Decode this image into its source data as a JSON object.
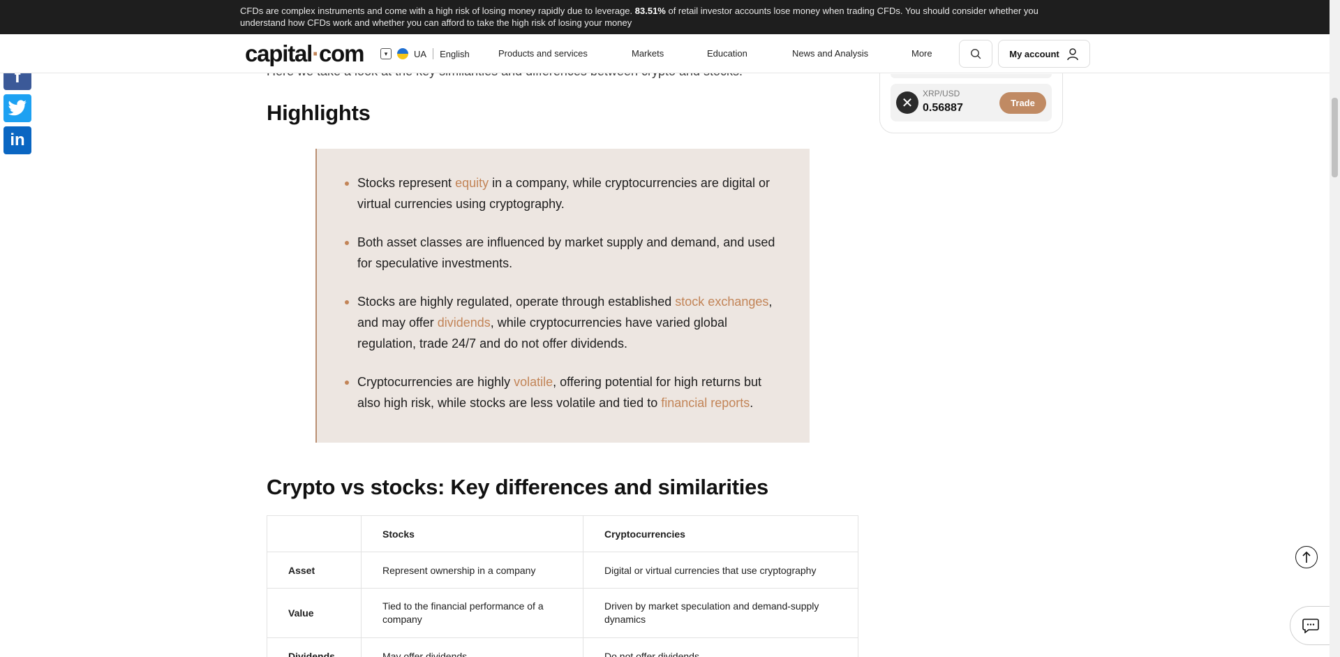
{
  "risk_banner": {
    "text_before": "CFDs are complex instruments and come with a high risk of losing money rapidly due to leverage. ",
    "percent": "83.51%",
    "text_after": " of retail investor accounts lose money when trading CFDs. You should consider whether you understand how CFDs work and whether you can afford to take the high risk of losing your money"
  },
  "header": {
    "logo_left": "capital",
    "logo_dot": "·",
    "logo_right": "com",
    "region": "UA",
    "language": "English",
    "nav": [
      "Products and services",
      "Markets",
      "Education",
      "News and Analysis",
      "More"
    ],
    "account_label": "My account"
  },
  "article": {
    "intro": "Here we take a look at the key similarities and differences between crypto and stocks.",
    "highlights_title": "Highlights",
    "highlights": {
      "b1_pre": "Stocks represent ",
      "b1_link": "equity",
      "b1_post": " in a company, while cryptocurrencies are digital or virtual currencies using cryptography.",
      "b2": "Both asset classes are influenced by market supply and demand, and used for speculative investments.",
      "b3_pre": "Stocks are highly regulated, operate through established ",
      "b3_link1": "stock exchanges",
      "b3_mid": ", and may offer ",
      "b3_link2": "dividends",
      "b3_post": ", while cryptocurrencies have varied global regulation, trade 24/7 and do not offer dividends.",
      "b4_pre": "Cryptocurrencies are highly ",
      "b4_link1": "volatile",
      "b4_mid": ", offering potential for high returns but also high risk, while stocks are less volatile and tied to ",
      "b4_link2": "financial reports",
      "b4_post": "."
    },
    "comparison_title": "Crypto vs stocks: Key differences and similarities",
    "table": {
      "headers": [
        "",
        "Stocks",
        "Cryptocurrencies"
      ],
      "rows": [
        {
          "label": "Asset",
          "stocks": "Represent ownership in a company",
          "crypto": "Digital or virtual currencies that use cryptography"
        },
        {
          "label": "Value",
          "stocks": "Tied to the financial performance of a company",
          "crypto": "Driven by market speculation and demand-supply dynamics"
        },
        {
          "label": "Dividends",
          "stocks": "May offer dividends",
          "crypto": "Do not offer dividends"
        }
      ]
    }
  },
  "widget": {
    "symbol": "XRP/USD",
    "price": "0.56887",
    "trade_label": "Trade"
  },
  "icons": {
    "social": [
      "facebook-icon",
      "twitter-icon",
      "linkedin-icon"
    ],
    "other": [
      "search-icon",
      "user-icon",
      "arrow-up-icon",
      "chat-icon",
      "xrp-icon",
      "chevron-down-icon",
      "flag-icon"
    ]
  },
  "colors": {
    "accent": "#c28457",
    "banner_bg": "#1e1e1e",
    "highlight_bg": "#ede6e1",
    "trade_button": "#c08a63"
  }
}
